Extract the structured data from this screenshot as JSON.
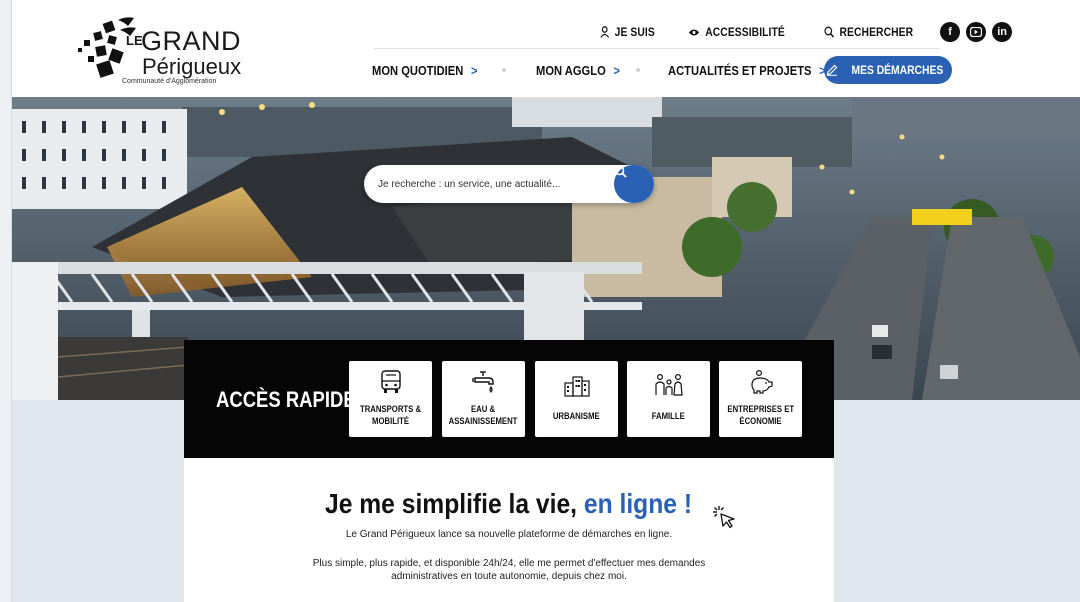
{
  "logo": {
    "le": "LE",
    "grand": "GRAND",
    "perigueux": "Périgueux",
    "subtitle": "Communauté d'Agglomération"
  },
  "top_links": [
    {
      "label": "JE SUIS",
      "icon": "user-icon"
    },
    {
      "label": "ACCESSIBILITÉ",
      "icon": "eye-icon"
    },
    {
      "label": "RECHERCHER",
      "icon": "search-icon"
    }
  ],
  "socials": [
    {
      "icon": "facebook-icon",
      "glyph": "f"
    },
    {
      "icon": "youtube-icon",
      "glyph": "▶"
    },
    {
      "icon": "linkedin-icon",
      "glyph": "in"
    }
  ],
  "nav": {
    "items": [
      {
        "label": "MON QUOTIDIEN",
        "chevron": ">"
      },
      {
        "label": "MON AGGLO",
        "chevron": ">"
      },
      {
        "label": "ACTUALITÉS ET PROJETS",
        "chevron": ">"
      }
    ],
    "cta_label": "MES DÉMARCHES"
  },
  "search": {
    "placeholder": "Je recherche : un service, une actualité..."
  },
  "quick_access": {
    "title": "ACCÈS RAPIDE",
    "tiles": [
      {
        "line1": "TRANSPORTS &",
        "line2": "MOBILITÉ",
        "icon": "bus-icon"
      },
      {
        "line1": "EAU &",
        "line2": "ASSAINISSEMENT",
        "icon": "water-tap-icon"
      },
      {
        "line1": "URBANISME",
        "line2": "",
        "icon": "buildings-icon"
      },
      {
        "line1": "FAMILLE",
        "line2": "",
        "icon": "family-icon"
      },
      {
        "line1": "ENTREPRISES ET",
        "line2": "ÉCONOMIE",
        "icon": "piggy-bank-icon"
      }
    ]
  },
  "promo": {
    "headline_main": "Je me simplifie la vie, ",
    "headline_accent": "en ligne !",
    "paragraph1": "Le Grand Périgueux lance sa nouvelle plateforme de démarches en ligne.",
    "paragraph2": "Plus simple, plus rapide, et disponible 24h/24, elle me permet d'effectuer mes demandes administratives en toute autonomie, depuis chez moi."
  },
  "colors": {
    "accent": "#2a61b5",
    "quick_bg": "#050505",
    "lower_bg": "#dfe6ee"
  }
}
